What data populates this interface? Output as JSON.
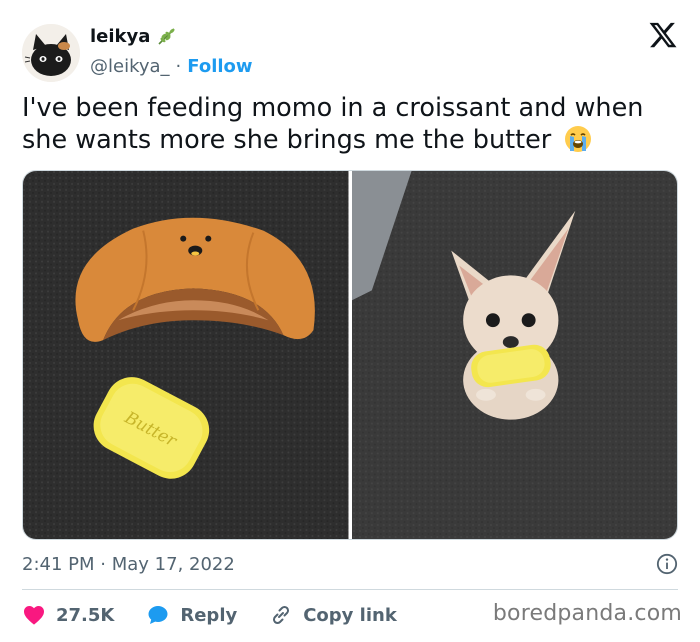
{
  "author": {
    "display_name": "leikya",
    "name_emoji": "herb-icon",
    "handle": "@leikya_",
    "separator": "·",
    "follow_label": "Follow"
  },
  "tweet": {
    "text": "I've been feeding momo in a croissant and when she wants more she brings me the butter",
    "trailing_emoji": "loudly-crying-face-icon"
  },
  "media": {
    "images": [
      {
        "alt_icon": "croissant-plush-toy-image",
        "toy_label": "Butter"
      },
      {
        "alt_icon": "chihuahua-with-butter-toy-image"
      }
    ]
  },
  "meta": {
    "time": "2:41 PM",
    "separator": "·",
    "date": "May 17, 2022"
  },
  "actions": {
    "like_count": "27.5K",
    "reply_label": "Reply",
    "copy_label": "Copy link"
  },
  "watermark": "boredpanda.com",
  "colors": {
    "accent_blue": "#1d9bf0",
    "like_red": "#f91880",
    "text_primary": "#0f1419",
    "text_secondary": "#536471"
  }
}
